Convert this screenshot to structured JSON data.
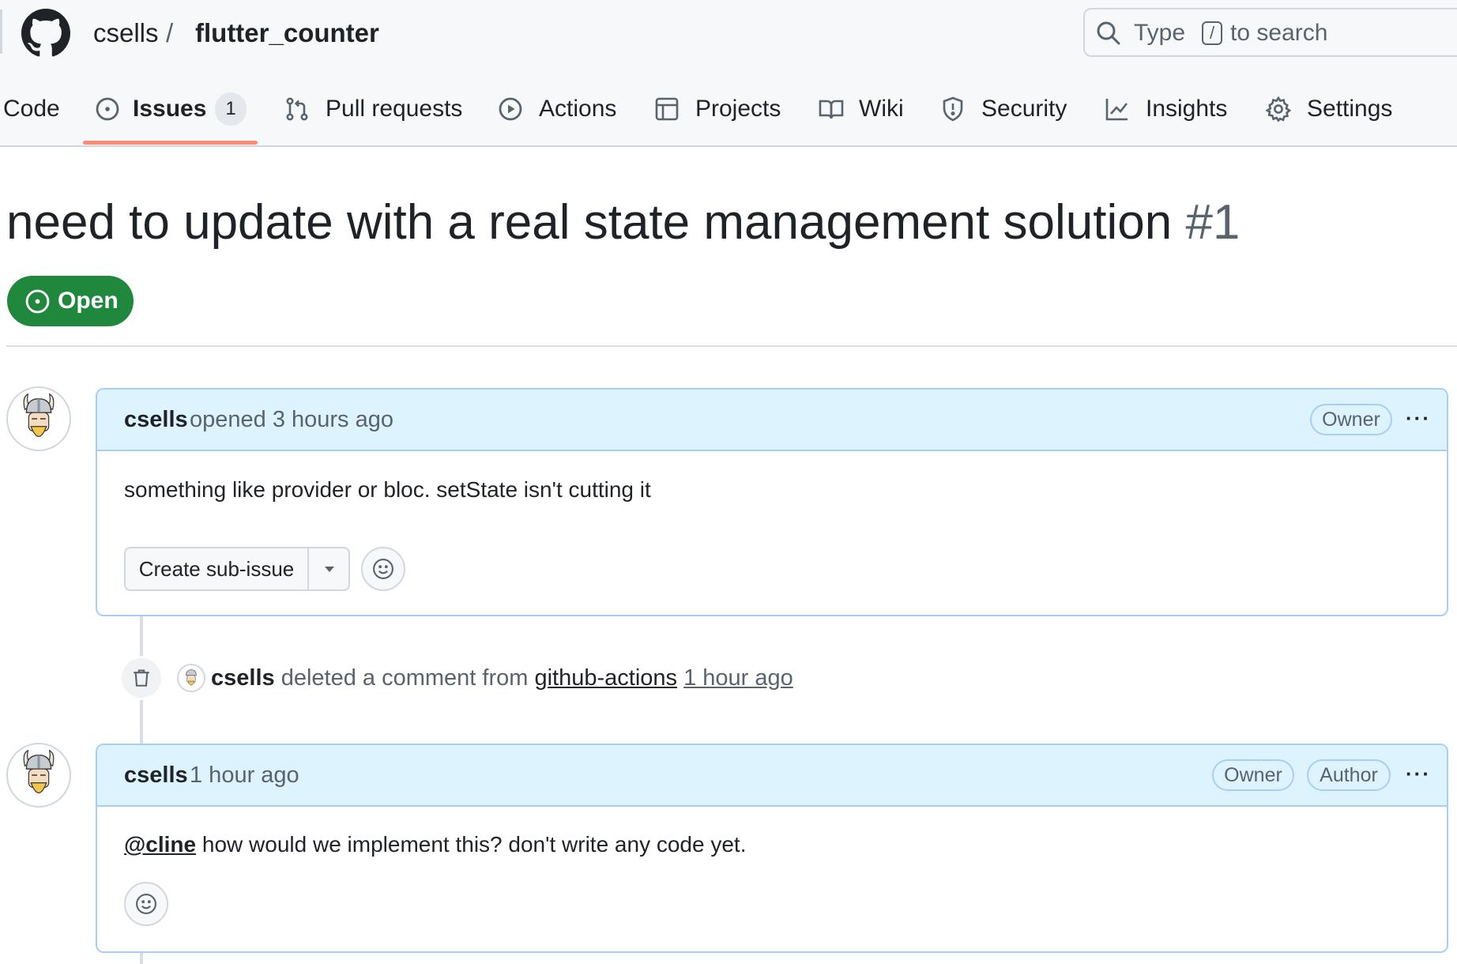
{
  "header": {
    "owner": "csells",
    "separator": "/",
    "repo": "flutter_counter",
    "search": {
      "prefix": "Type",
      "key": "/",
      "suffix": "to search"
    }
  },
  "tabs": [
    {
      "label": "Code",
      "icon": "code-icon"
    },
    {
      "label": "Issues",
      "icon": "issue-opened-icon",
      "counter": "1",
      "selected": true
    },
    {
      "label": "Pull requests",
      "icon": "git-pull-request-icon"
    },
    {
      "label": "Actions",
      "icon": "play-icon"
    },
    {
      "label": "Projects",
      "icon": "table-icon"
    },
    {
      "label": "Wiki",
      "icon": "book-icon"
    },
    {
      "label": "Security",
      "icon": "shield-icon"
    },
    {
      "label": "Insights",
      "icon": "graph-icon"
    },
    {
      "label": "Settings",
      "icon": "gear-icon"
    }
  ],
  "issue": {
    "title": "need to update with a real state management solution",
    "number": "#1",
    "state": "Open"
  },
  "comments": [
    {
      "author": "csells",
      "meta": "opened 3 hours ago",
      "badges": [
        "Owner"
      ],
      "body": "something like provider or bloc. setState isn't cutting it",
      "sub_issue_button": "Create sub-issue"
    },
    {
      "author": "csells",
      "meta": "1 hour ago",
      "badges": [
        "Owner",
        "Author"
      ],
      "mention": "@cline",
      "body": " how would we implement this? don't write any code yet."
    }
  ],
  "event": {
    "actor": "csells",
    "action": "deleted a comment from",
    "target": "github-actions",
    "time": "1 hour ago"
  },
  "colors": {
    "open_green": "#1f883d",
    "comment_header_bg": "#ddf4ff",
    "comment_border": "#a8cdfb",
    "tab_underline": "#fd8c73"
  },
  "kebab": "···"
}
